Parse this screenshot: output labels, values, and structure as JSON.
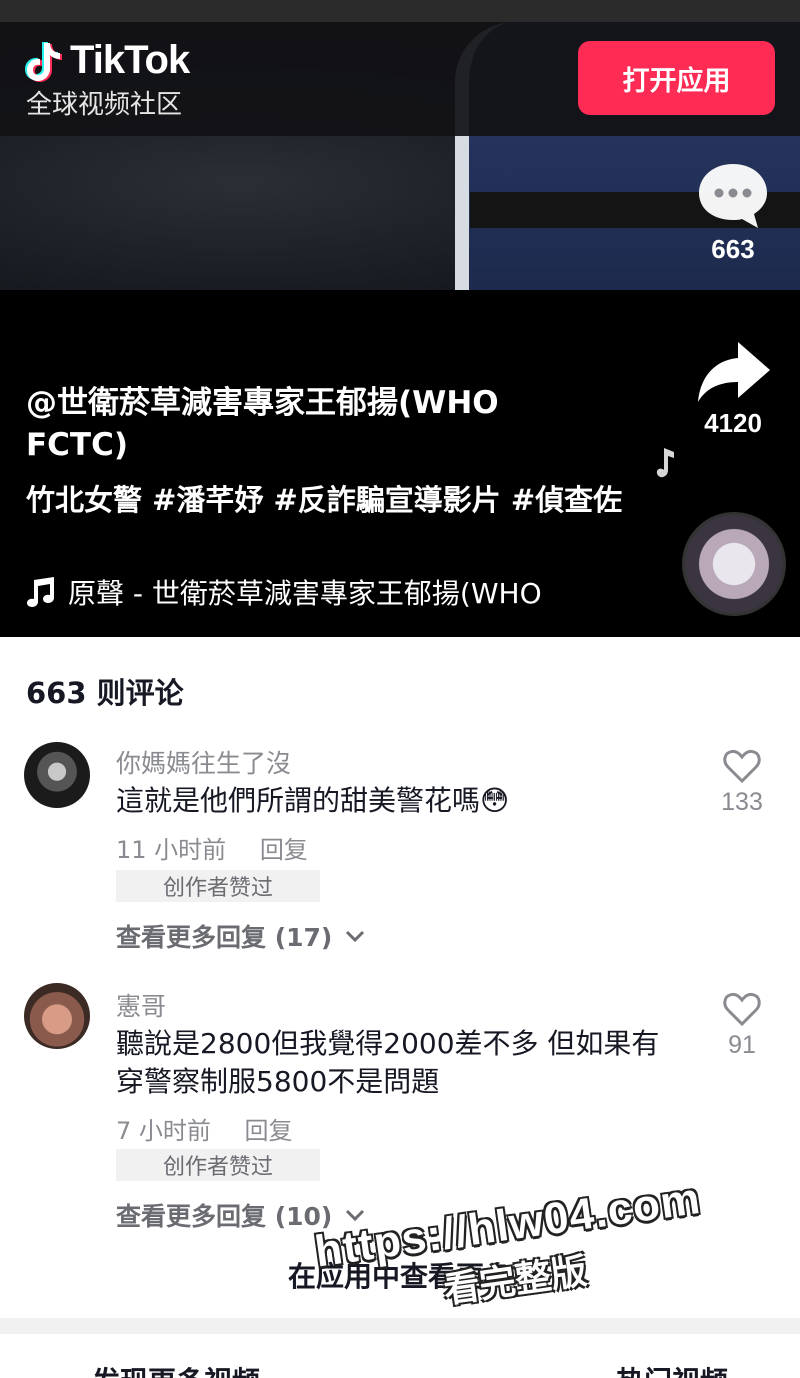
{
  "header": {
    "logo_text": "TikTok",
    "tagline": "全球视频社区",
    "open_app_button": "打开应用"
  },
  "video": {
    "comment_count": "663",
    "share_count": "4120",
    "author": "@世衛菸草減害專家王郁揚(WHO FCTC)",
    "caption": "竹北女警 #潘芊妤 #反詐騙宣導影片 #偵查佐",
    "music": "原聲 - 世衛菸草減害專家王郁揚(WHO",
    "icons": [
      "comment-icon",
      "share-icon",
      "music-note-icon"
    ]
  },
  "comments": {
    "header": "663 则评论",
    "items": [
      {
        "username": "你媽媽往生了沒",
        "text": "這就是他們所謂的甜美警花嗎😳",
        "time": "11 小时前",
        "reply": "回复",
        "badge": "创作者赞过",
        "view_more": "查看更多回复 (17)",
        "likes": "133"
      },
      {
        "username": "憲哥",
        "text": "聽說是2800但我覺得2000差不多 但如果有穿警察制服5800不是問題",
        "time": "7 小时前",
        "reply": "回复",
        "badge": "创作者赞过",
        "view_more": "查看更多回复 (10)",
        "likes": "91"
      }
    ],
    "view_in_app": "在应用中查看更多"
  },
  "watermark": {
    "line1": "https://hlw04.com",
    "line2": "看完整版"
  },
  "bottom_tabs": [
    "发现更多视频",
    "热门视频"
  ],
  "colors": {
    "accent": "#fe2c55",
    "text": "#161823",
    "muted": "#8a8b91"
  }
}
